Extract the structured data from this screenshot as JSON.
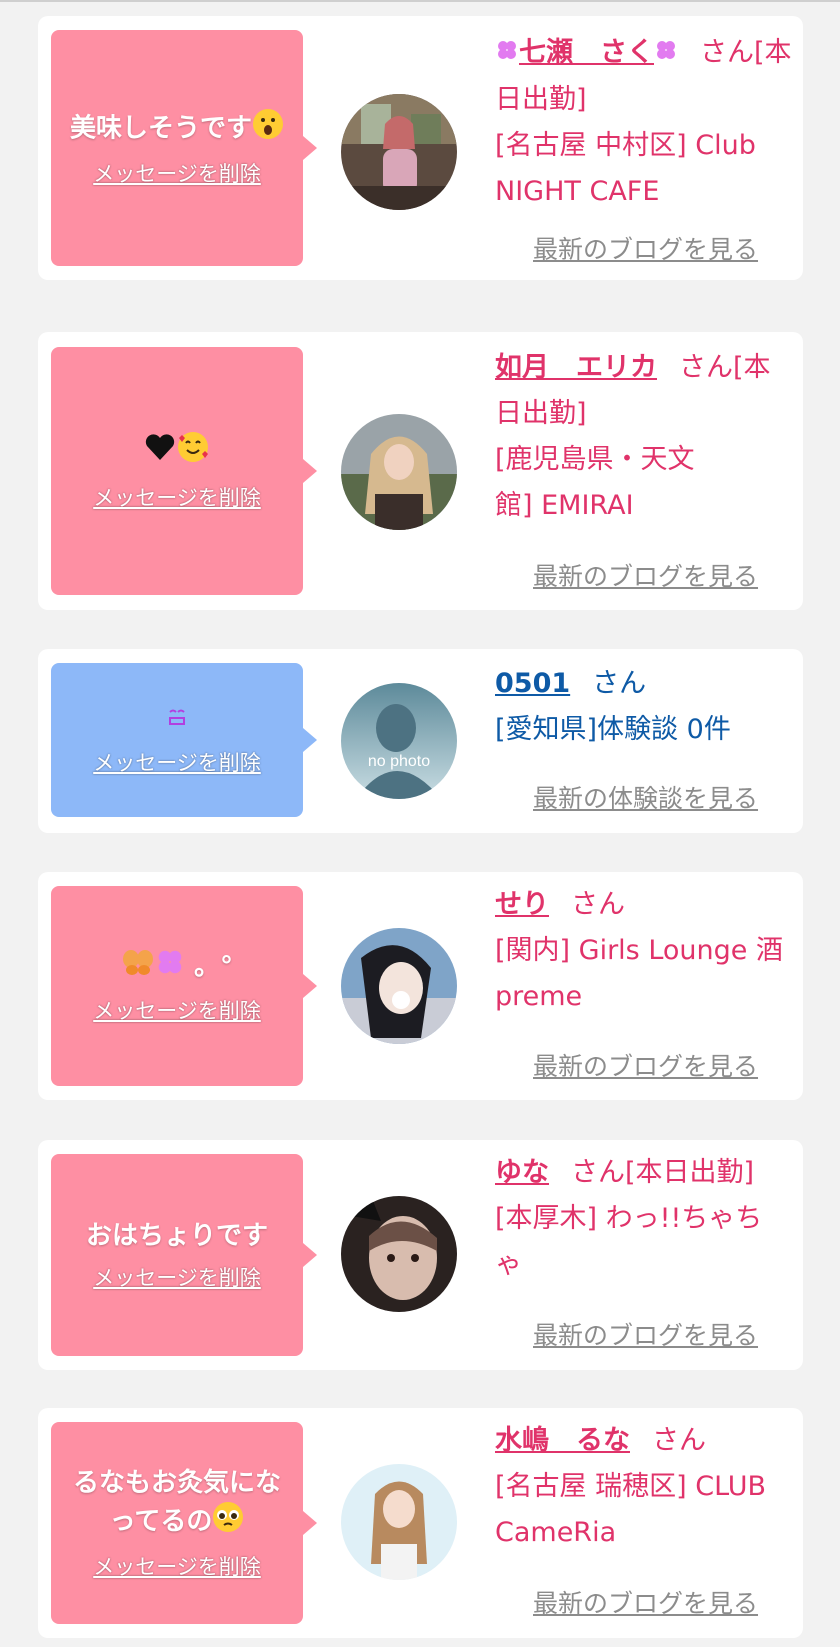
{
  "cards": [
    {
      "message": "美味しそうです",
      "delete_label": "メッセージを削除",
      "name": "七瀬　さく",
      "lines": [
        "さん[本日出勤]",
        "[名古屋 中村区] Club",
        "NIGHT CAFE"
      ],
      "blog_label": "最新のブログを見る",
      "bubble_color": "#fe8fa3"
    },
    {
      "message": "",
      "delete_label": "メッセージを削除",
      "name": "如月　エリカ",
      "lines": [
        "さん[本日出勤]",
        "[鹿児島県・天文",
        "館] EMIRAI"
      ],
      "blog_label": "最新のブログを見る",
      "bubble_color": "#fe8fa3"
    },
    {
      "message": "",
      "delete_label": "メッセージを削除",
      "name": "0501",
      "lines": [
        "さん",
        "[愛知県]体験談 0件"
      ],
      "blog_label": "最新の体験談を見る",
      "avatar_text": "no photo",
      "bubble_color": "#8db8f8"
    },
    {
      "message": "。°",
      "delete_label": "メッセージを削除",
      "name": "せり",
      "lines": [
        "さん",
        "[関内] Girls Lounge 酒",
        "preme"
      ],
      "blog_label": "最新のブログを見る",
      "bubble_color": "#fe8fa3"
    },
    {
      "message": "おはちょりです",
      "delete_label": "メッセージを削除",
      "name": "ゆな",
      "lines": [
        "さん[本日出勤]",
        "[本厚木] わっ!!ちゃち",
        "ゃ"
      ],
      "blog_label": "最新のブログを見る",
      "bubble_color": "#fe8fa3"
    },
    {
      "message_line1": "るなもお灸気にな",
      "message_line2": "ってるの",
      "delete_label": "メッセージを削除",
      "name": "水嶋　るな",
      "lines": [
        "さん",
        "[名古屋 瑞穂区] CLUB",
        "CameRia"
      ],
      "blog_label": "最新のブログを見る",
      "bubble_color": "#fe8fa3"
    }
  ]
}
